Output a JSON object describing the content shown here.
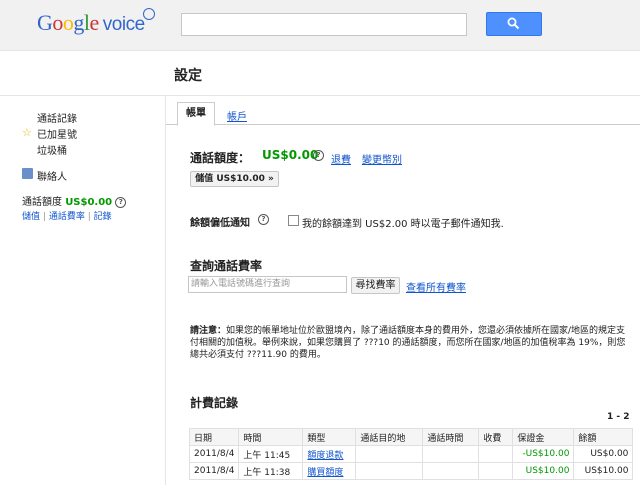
{
  "header": {
    "logo_google": [
      "G",
      "o",
      "o",
      "g",
      "l",
      "e"
    ],
    "logo_voice": "voice",
    "search_placeholder": ""
  },
  "page_title": "設定",
  "sidebar": {
    "history": "通話記錄",
    "starred": "已加星號",
    "trash": "垃圾桶",
    "contacts": "聯絡人",
    "credit_label": "通話額度",
    "credit_amount": "US$0.00",
    "links": {
      "topup": "儲值",
      "rates": "通話費率",
      "history": "記錄"
    }
  },
  "tabs": {
    "account": "帳單",
    "accounts": "帳戶"
  },
  "billing": {
    "credit_label": "通話額度：",
    "credit_amount": "US$0.00",
    "refund_link": "退費",
    "change_link": "變更幣別",
    "topup_button": "儲值 US$10.00 »",
    "low_balance_label": "餘額偏低通知",
    "low_balance_text": "我的餘額達到 US$2.00 時以電子郵件通知我.",
    "rates_title": "查詢通話費率",
    "rates_placeholder": "請輸入電話號碼進行查詢",
    "rates_button": "尋找費率",
    "rates_all_link": "查看所有費率",
    "note_label": "請注意：",
    "note_text": "如果您的帳單地址位於歐盟境內，除了通話額度本身的費用外，您還必須依據所在國家/地區的規定支付相關的加值稅。舉例來說，如果您購買了 ???10 的通話額度，而您所在國家/地區的加值稅率為 19%，則您總共必須支付 ???11.90 的費用。",
    "history_title": "計費記錄",
    "pager": "1 - 2",
    "columns": [
      "日期",
      "時間",
      "類型",
      "通話目的地",
      "通話時間",
      "收費",
      "保證金",
      "餘額"
    ],
    "rows": [
      {
        "date": "2011/8/4",
        "time": "上午 11:45",
        "type": "額度退款",
        "dest": "",
        "duration": "",
        "charge": "",
        "deposit": "-US$10.00",
        "balance": "US$0.00"
      },
      {
        "date": "2011/8/4",
        "time": "上午 11:38",
        "type": "購買額度",
        "dest": "",
        "duration": "",
        "charge": "",
        "deposit": "US$10.00",
        "balance": "US$10.00"
      }
    ]
  },
  "colors": {
    "accent_blue": "#4d90fe",
    "link": "#1155cc",
    "money_green": "#009900"
  }
}
